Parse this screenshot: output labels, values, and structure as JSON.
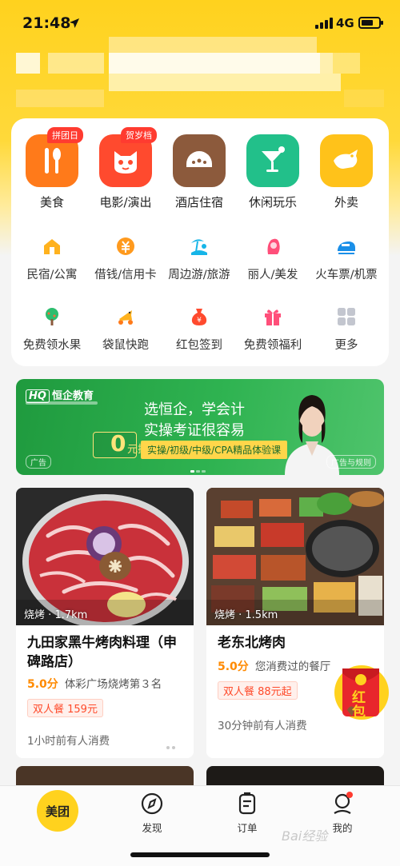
{
  "status_bar": {
    "time": "21:48",
    "network": "4G"
  },
  "big_categories": [
    {
      "label": "美食",
      "tag": "拼团日",
      "color": "#ff7a1a"
    },
    {
      "label": "电影/演出",
      "tag": "贺岁档",
      "color": "#ff4a2e"
    },
    {
      "label": "酒店住宿",
      "tag": "",
      "color": "#8c5a3c"
    },
    {
      "label": "休闲玩乐",
      "tag": "",
      "color": "#22c08a"
    },
    {
      "label": "外卖",
      "tag": "",
      "color": "#ffc21a"
    }
  ],
  "small_categories": [
    {
      "label": "民宿/公寓",
      "icon": "house-icon"
    },
    {
      "label": "借钱/信用卡",
      "icon": "coin-icon"
    },
    {
      "label": "周边游/旅游",
      "icon": "beach-icon"
    },
    {
      "label": "丽人/美发",
      "icon": "woman-icon"
    },
    {
      "label": "火车票/机票",
      "icon": "train-icon"
    },
    {
      "label": "免费领水果",
      "icon": "tree-icon"
    },
    {
      "label": "袋鼠快跑",
      "icon": "kangaroo-icon"
    },
    {
      "label": "红包签到",
      "icon": "money-bag-icon"
    },
    {
      "label": "免费领福利",
      "icon": "gift-icon"
    },
    {
      "label": "更多",
      "icon": "grid-icon"
    }
  ],
  "banner": {
    "brand": "恒企教育",
    "brand_mark": "HQ",
    "line1": "选恒企，学会计",
    "line2": "实操考证很容易",
    "price": "0",
    "price_suffix": "元抢",
    "pill": "实操/初级/中级/CPA精品体验课",
    "ad_label": "广告",
    "rules_label": "广告与规则"
  },
  "feed": [
    {
      "tag": "烧烤 · 1.7km",
      "title": "九田家黑牛烤肉料理（申碑路店）",
      "score": "5.0分",
      "rank": "体彩广场烧烤第３名",
      "deal": "双人餐 159元",
      "footer": "1小时前有人消费"
    },
    {
      "tag": "烧烤 · 1.5km",
      "title": "老东北烤肉",
      "score": "5.0分",
      "rank": "您消费过的餐厅",
      "deal": "双人餐 88元起",
      "footer": "30分钟前有人消费"
    }
  ],
  "red_packet": {
    "label": "红包"
  },
  "tabs": [
    {
      "label": "美团"
    },
    {
      "label": "发现"
    },
    {
      "label": "订单"
    },
    {
      "label": "我的"
    }
  ],
  "watermark": "Bai经验"
}
